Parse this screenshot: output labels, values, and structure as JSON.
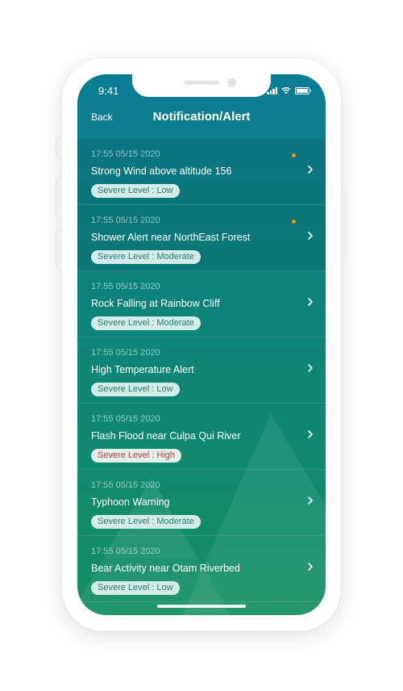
{
  "status_bar": {
    "time": "9:41"
  },
  "header": {
    "back_label": "Back",
    "title": "Notification/Alert"
  },
  "colors": {
    "unread_dot": "#f0941e",
    "badge_bg": "#d4ece8",
    "badge_text": "#2a7d71",
    "badge_high_text": "#d33a3a",
    "screen_top": "#0b7d95",
    "screen_bottom": "#168f63"
  },
  "notifications": [
    {
      "time": "17:55 05/15 2020",
      "title": "Strong Wind above altitude 156",
      "level": "Severe Level : Low",
      "unread": true
    },
    {
      "time": "17:55 05/15 2020",
      "title": "Shower Alert near NorthEast Forest",
      "level": "Severe Level : Moderate",
      "unread": true
    },
    {
      "time": "17:55 05/15 2020",
      "title": "Rock Falling at Rainbow Cliff",
      "level": "Severe Level : Moderate",
      "unread": false
    },
    {
      "time": "17:55 05/15 2020",
      "title": "High Temperature Alert",
      "level": "Severe Level : Low",
      "unread": false
    },
    {
      "time": "17:55 05/15 2020",
      "title": "Flash Flood near Culpa Qui River",
      "level": "Severe Level : High",
      "unread": false
    },
    {
      "time": "17:55 05/15 2020",
      "title": "Typhoon Warning",
      "level": "Severe Level : Moderate",
      "unread": false
    },
    {
      "time": "17:55 05/15 2020",
      "title": "Bear Activity near Otam Riverbed",
      "level": "Severe Level : Low",
      "unread": false
    }
  ],
  "icons": {
    "chevron": "chevron-right-icon",
    "signal": "cellular-signal-icon",
    "wifi": "wifi-icon",
    "battery": "battery-icon"
  }
}
